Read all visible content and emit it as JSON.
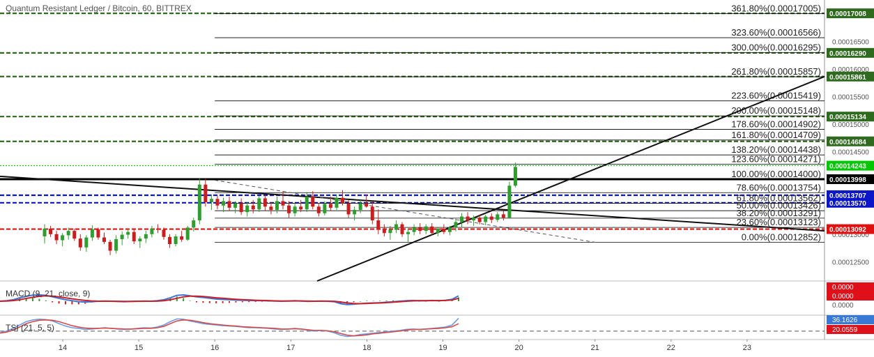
{
  "title": "Quantum Resistant Ledger / Bitcoin, 60, BITTREX",
  "chart_data": {
    "type": "candlestick",
    "x_ticks": [
      "14",
      "15",
      "16",
      "17",
      "18",
      "19",
      "20",
      "21",
      "22",
      "23"
    ],
    "y_ticks": [
      "0.00016500",
      "0.00016000",
      "0.00015500",
      "0.00015000",
      "0.00014500",
      "0.00013000",
      "0.00012500"
    ],
    "ylim": [
      0.0001215,
      0.0001725
    ],
    "fib_levels": [
      {
        "label": "361.80%(0.00017005)",
        "value": 0.00017005
      },
      {
        "label": "323.60%(0.00016566)",
        "value": 0.00016566
      },
      {
        "label": "300.00%(0.00016295)",
        "value": 0.00016295
      },
      {
        "label": "261.80%(0.00015857)",
        "value": 0.00015857
      },
      {
        "label": "223.60%(0.00015419)",
        "value": 0.00015419
      },
      {
        "label": "200.00%(0.00015148)",
        "value": 0.00015148
      },
      {
        "label": "178.60%(0.00014902)",
        "value": 0.00014902
      },
      {
        "label": "161.80%(0.00014709)",
        "value": 0.00014709
      },
      {
        "label": "138.20%(0.00014438)",
        "value": 0.00014438
      },
      {
        "label": "123.60%(0.00014271)",
        "value": 0.00014271
      },
      {
        "label": "100.00%(0.00014000)",
        "value": 0.00014
      },
      {
        "label": "78.60%(0.00013754)",
        "value": 0.00013754
      },
      {
        "label": "61.80%(0.00013562)",
        "value": 0.00013562
      },
      {
        "label": "50.00%(0.00013426)",
        "value": 0.00013426
      },
      {
        "label": "38.20%(0.00013291)",
        "value": 0.00013291
      },
      {
        "label": "23.60%(0.00013123)",
        "value": 0.00013123
      },
      {
        "label": "0.00%(0.00012852)",
        "value": 0.00012852
      }
    ],
    "horizontal_levels": [
      {
        "label": "0.00017008",
        "value": 0.00017008,
        "color": "#2e6b1e"
      },
      {
        "label": "0.00016290",
        "value": 0.0001629,
        "color": "#2e6b1e"
      },
      {
        "label": "0.00015861",
        "value": 0.00015861,
        "color": "#2e6b1e"
      },
      {
        "label": "0.00015134",
        "value": 0.00015134,
        "color": "#2e6b1e"
      },
      {
        "label": "0.00014684",
        "value": 0.00014684,
        "color": "#2e6b1e"
      },
      {
        "label": "0.00014243",
        "value": 0.00014243,
        "color": "#00c800"
      },
      {
        "label": "0.00013998",
        "value": 0.00013998,
        "color": "#000000"
      },
      {
        "label": "0.00013707",
        "value": 0.00013707,
        "color": "#0b16c8"
      },
      {
        "label": "0.00013570",
        "value": 0.0001357,
        "color": "#0b16c8"
      },
      {
        "label": "0.00013092",
        "value": 0.00013092,
        "color": "#e01010"
      }
    ],
    "candles": [
      [
        0.0001296,
        0.0001318,
        0.0001283,
        0.000131
      ],
      [
        0.000131,
        0.0001315,
        0.0001295,
        0.00013
      ],
      [
        0.00013,
        0.0001306,
        0.0001282,
        0.0001289
      ],
      [
        0.0001289,
        0.0001302,
        0.0001278,
        0.0001298
      ],
      [
        0.0001298,
        0.0001312,
        0.000129,
        0.0001306
      ],
      [
        0.0001306,
        0.000131,
        0.0001288,
        0.0001292
      ],
      [
        0.0001292,
        0.00013,
        0.000127,
        0.0001276
      ],
      [
        0.0001276,
        0.0001298,
        0.0001268,
        0.0001294
      ],
      [
        0.0001294,
        0.0001316,
        0.0001288,
        0.0001309
      ],
      [
        0.0001309,
        0.0001312,
        0.000129,
        0.0001294
      ],
      [
        0.0001294,
        0.0001303,
        0.0001282,
        0.0001286
      ],
      [
        0.0001286,
        0.000129,
        0.0001262,
        0.000127
      ],
      [
        0.000127,
        0.0001298,
        0.0001265,
        0.0001291
      ],
      [
        0.0001291,
        0.0001305,
        0.000128,
        0.0001299
      ],
      [
        0.0001299,
        0.000131,
        0.0001292,
        0.0001304
      ],
      [
        0.0001304,
        0.0001308,
        0.0001282,
        0.0001287
      ],
      [
        0.0001287,
        0.0001296,
        0.0001275,
        0.0001292
      ],
      [
        0.0001292,
        0.0001306,
        0.0001284,
        0.00013
      ],
      [
        0.00013,
        0.0001315,
        0.0001294,
        0.000131
      ],
      [
        0.000131,
        0.0001318,
        0.0001302,
        0.0001308
      ],
      [
        0.0001308,
        0.0001312,
        0.000129,
        0.0001295
      ],
      [
        0.0001295,
        0.00013,
        0.0001275,
        0.0001282
      ],
      [
        0.0001282,
        0.00013,
        0.0001278,
        0.0001296
      ],
      [
        0.0001296,
        0.0001306,
        0.0001286,
        0.000129
      ],
      [
        0.000129,
        0.0001315,
        0.0001288,
        0.0001312
      ],
      [
        0.0001312,
        0.000133,
        0.0001305,
        0.0001325
      ],
      [
        0.0001325,
        0.0001402,
        0.0001318,
        0.000139
      ],
      [
        0.000139,
        0.00014,
        0.000135,
        0.0001358
      ],
      [
        0.0001358,
        0.0001372,
        0.0001344,
        0.0001364
      ],
      [
        0.0001364,
        0.000137,
        0.0001345,
        0.0001352
      ],
      [
        0.0001352,
        0.0001366,
        0.000134,
        0.000136
      ],
      [
        0.000136,
        0.0001368,
        0.0001342,
        0.0001348
      ],
      [
        0.0001348,
        0.000136,
        0.0001338,
        0.0001356
      ],
      [
        0.0001356,
        0.0001365,
        0.0001335,
        0.000134
      ],
      [
        0.000134,
        0.0001358,
        0.0001332,
        0.0001352
      ],
      [
        0.0001352,
        0.0001362,
        0.0001338,
        0.0001345
      ],
      [
        0.0001345,
        0.000137,
        0.000134,
        0.0001365
      ],
      [
        0.0001365,
        0.0001372,
        0.0001342,
        0.000135
      ],
      [
        0.000135,
        0.0001358,
        0.0001336,
        0.0001344
      ],
      [
        0.0001344,
        0.0001368,
        0.0001338,
        0.000136
      ],
      [
        0.000136,
        0.0001378,
        0.0001345,
        0.0001352
      ],
      [
        0.0001352,
        0.000136,
        0.000133,
        0.0001338
      ],
      [
        0.0001338,
        0.0001355,
        0.0001332,
        0.000135
      ],
      [
        0.000135,
        0.0001362,
        0.000134,
        0.0001345
      ],
      [
        0.0001345,
        0.0001375,
        0.000134,
        0.0001368
      ],
      [
        0.0001368,
        0.0001378,
        0.0001345,
        0.000135
      ],
      [
        0.000135,
        0.0001357,
        0.0001332,
        0.0001338
      ],
      [
        0.0001338,
        0.000136,
        0.0001334,
        0.0001355
      ],
      [
        0.0001355,
        0.0001368,
        0.0001342,
        0.0001348
      ],
      [
        0.0001348,
        0.0001372,
        0.0001344,
        0.0001366
      ],
      [
        0.0001366,
        0.000138,
        0.0001352,
        0.0001356
      ],
      [
        0.0001356,
        0.0001362,
        0.000133,
        0.0001336
      ],
      [
        0.0001336,
        0.000135,
        0.0001325,
        0.0001344
      ],
      [
        0.0001344,
        0.0001362,
        0.0001338,
        0.0001356
      ],
      [
        0.0001356,
        0.0001372,
        0.0001348,
        0.000135
      ],
      [
        0.000135,
        0.000136,
        0.0001318,
        0.0001325
      ],
      [
        0.0001325,
        0.0001345,
        0.00013,
        0.000131
      ],
      [
        0.000131,
        0.0001318,
        0.0001296,
        0.0001302
      ],
      [
        0.0001302,
        0.0001315,
        0.000129,
        0.0001308
      ],
      [
        0.0001308,
        0.0001325,
        0.0001302,
        0.0001318
      ],
      [
        0.0001318,
        0.0001322,
        0.0001295,
        0.00013
      ],
      [
        0.00013,
        0.000131,
        0.0001286,
        0.0001304
      ],
      [
        0.0001304,
        0.0001318,
        0.0001298,
        0.0001312
      ],
      [
        0.0001312,
        0.000132,
        0.00013,
        0.0001306
      ],
      [
        0.0001306,
        0.0001318,
        0.00013,
        0.0001314
      ],
      [
        0.0001314,
        0.000132,
        0.0001298,
        0.0001302
      ],
      [
        0.0001302,
        0.0001312,
        0.0001296,
        0.000131
      ],
      [
        0.000131,
        0.0001318,
        0.00013,
        0.0001304
      ],
      [
        0.0001304,
        0.0001315,
        0.0001298,
        0.0001312
      ],
      [
        0.0001312,
        0.0001328,
        0.0001305,
        0.0001322
      ],
      [
        0.0001322,
        0.0001338,
        0.0001312,
        0.0001332
      ],
      [
        0.0001332,
        0.000134,
        0.0001318,
        0.0001325
      ],
      [
        0.0001325,
        0.0001334,
        0.0001315,
        0.000133
      ],
      [
        0.000133,
        0.0001336,
        0.0001318,
        0.0001322
      ],
      [
        0.0001322,
        0.0001335,
        0.0001316,
        0.0001332
      ],
      [
        0.0001332,
        0.0001338,
        0.000132,
        0.0001326
      ],
      [
        0.0001326,
        0.000134,
        0.0001322,
        0.0001336
      ],
      [
        0.0001336,
        0.0001342,
        0.0001325,
        0.000133
      ],
      [
        0.000133,
        0.0001395,
        0.0001328,
        0.0001388
      ],
      [
        0.0001388,
        0.000143,
        0.0001385,
        0.0001422
      ]
    ],
    "macd": {
      "label": "MACD (9, 21, close, 9)",
      "value_labels": [
        "0.0000",
        "0.0000",
        "0.0000"
      ],
      "macd_line": [
        0,
        0.05,
        0.15,
        0.35,
        0.5,
        0.62,
        0.65,
        0.6,
        0.45,
        0.3,
        0.15,
        0.05,
        -0.05,
        -0.08,
        -0.05,
        0.0,
        0.02,
        0.0,
        -0.03,
        -0.05,
        -0.02,
        0.0,
        0.02,
        0.0,
        0.05,
        0.15,
        0.35,
        0.6,
        0.65,
        0.55,
        0.45,
        0.38,
        0.3,
        0.22,
        0.18,
        0.15,
        0.12,
        0.1,
        0.08,
        0.06,
        0.05,
        0.04,
        0.02,
        0.0,
        0.03,
        0.05,
        0.02,
        -0.02,
        0.0,
        0.02,
        0.0,
        -0.05,
        -0.25,
        -0.35,
        -0.3,
        -0.25,
        -0.2,
        -0.18,
        -0.15,
        -0.1,
        -0.05,
        0.0,
        0.05,
        0.08,
        0.05,
        0.05,
        0.08,
        0.05,
        0.1,
        0.2,
        0.55
      ],
      "signal_line": [
        0,
        0.02,
        0.06,
        0.15,
        0.28,
        0.4,
        0.5,
        0.55,
        0.52,
        0.45,
        0.35,
        0.25,
        0.15,
        0.08,
        0.03,
        0.0,
        0.0,
        0.0,
        -0.01,
        -0.02,
        -0.02,
        -0.01,
        0.0,
        0.0,
        0.01,
        0.05,
        0.15,
        0.3,
        0.45,
        0.52,
        0.52,
        0.48,
        0.42,
        0.35,
        0.3,
        0.25,
        0.2,
        0.16,
        0.13,
        0.1,
        0.08,
        0.06,
        0.04,
        0.02,
        0.02,
        0.03,
        0.03,
        0.01,
        0.0,
        0.01,
        0.01,
        -0.01,
        -0.08,
        -0.18,
        -0.24,
        -0.25,
        -0.23,
        -0.2,
        -0.18,
        -0.14,
        -0.1,
        -0.05,
        0.0,
        0.04,
        0.05,
        0.05,
        0.06,
        0.06,
        0.08,
        0.12,
        0.3
      ]
    },
    "tsi": {
      "label": "TSI (21, 5, 5)",
      "value_labels": [
        "36.1626",
        "20.0559"
      ],
      "tsi_line": [
        -5,
        0,
        8,
        18,
        28,
        33,
        35,
        34,
        30,
        22,
        15,
        10,
        8,
        5,
        6,
        8,
        10,
        8,
        6,
        5,
        6,
        8,
        10,
        9,
        12,
        18,
        28,
        36,
        35,
        30,
        26,
        22,
        20,
        18,
        16,
        15,
        14,
        12,
        10,
        10,
        9,
        8,
        6,
        5,
        6,
        8,
        6,
        2,
        0,
        2,
        0,
        -5,
        -12,
        -16,
        -14,
        -10,
        -8,
        -6,
        -4,
        -2,
        0,
        2,
        5,
        6,
        5,
        6,
        8,
        10,
        12,
        18,
        38
      ],
      "signal_line": [
        -6,
        -3,
        3,
        12,
        22,
        28,
        32,
        33,
        32,
        28,
        22,
        16,
        12,
        9,
        8,
        8,
        9,
        8,
        7,
        6,
        6,
        7,
        8,
        8,
        10,
        14,
        22,
        30,
        33,
        32,
        29,
        25,
        22,
        20,
        18,
        16,
        15,
        13,
        12,
        11,
        10,
        9,
        8,
        6,
        6,
        7,
        6,
        4,
        2,
        2,
        1,
        -2,
        -7,
        -12,
        -14,
        -13,
        -11,
        -8,
        -6,
        -4,
        -2,
        0,
        3,
        5,
        5,
        6,
        7,
        8,
        10,
        13,
        22
      ],
      "ylim": [
        -25,
        45
      ]
    }
  }
}
